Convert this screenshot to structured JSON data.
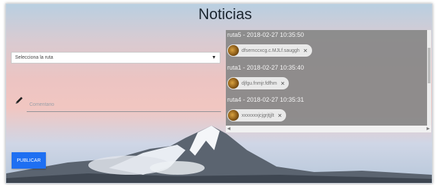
{
  "page": {
    "title": "Noticias"
  },
  "form": {
    "route_select": {
      "value": "Selecciona la ruta"
    },
    "comment": {
      "placeholder": "Comentario"
    },
    "publish_label": "PUBLICAR"
  },
  "news": [
    {
      "header": "ruta5 - 2018-02-27 10:35:50",
      "chip": "dfsernccxcg.c.MJLf.sauggh"
    },
    {
      "header": "ruta1 - 2018-02-27 10:35:40",
      "chip": "djfgu.fnmjr.fdfhm"
    },
    {
      "header": "ruta4 - 2018-02-27 10:35:31",
      "chip": "xxxxxxxjcjgrjtjjlt"
    }
  ],
  "icons": {
    "pencil": "pencil-icon",
    "dropdown": "caret-down-icon",
    "remove": "close-icon"
  },
  "colors": {
    "publish_button": "#1e6ff2",
    "news_panel": "#888888",
    "chip": "#e9e9e9"
  }
}
